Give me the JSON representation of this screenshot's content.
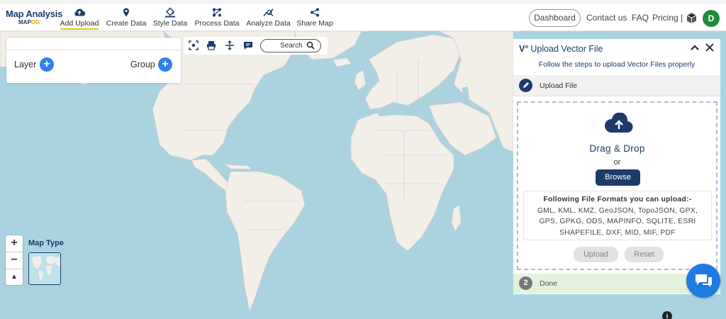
{
  "brand": {
    "title": "Map Analysis",
    "sub_prefix": "MAP",
    "sub_accent": "OG"
  },
  "nav": {
    "items": [
      {
        "label": "Add Upload",
        "icon": "cloud-upload-icon",
        "active": true
      },
      {
        "label": "Create Data",
        "icon": "map-pin-icon"
      },
      {
        "label": "Style Data",
        "icon": "paint-bucket-icon"
      },
      {
        "label": "Process Data",
        "icon": "process-nodes-icon"
      },
      {
        "label": "Analyze Data",
        "icon": "analyze-chart-icon"
      },
      {
        "label": "Share Map",
        "icon": "share-icon"
      }
    ],
    "dashboard_label": "Dashboard",
    "contact_label": "Contact us",
    "faq_label": "FAQ",
    "pricing_label": "Pricing |",
    "avatar_letter": "D"
  },
  "layer_panel": {
    "layer_label": "Layer",
    "group_label": "Group"
  },
  "map_toolbar": {
    "search_label": "Search"
  },
  "map_controls": {
    "zoom_in": "+",
    "zoom_out": "−",
    "north": "▲",
    "map_type_label": "Map Type"
  },
  "upload_panel": {
    "title": "Upload Vector File",
    "subtitle": "Follow the steps to upload Vector Files properly",
    "step1_label": "Upload File",
    "drag_drop": "Drag & Drop",
    "or": "or",
    "browse": "Browse",
    "formats_heading": "Following File Formats you can upload:-",
    "formats_line1": "GML, KML, KMZ, GeoJSON, TopoJSON, GPX,",
    "formats_line2": "GPS, GPKG, ODS, MAPINFO, SQLITE, ESRI",
    "formats_line3": "SHAPEFILE, DXF, MID, MIF, PDF",
    "upload_button": "Upload",
    "reset_button": "Reset",
    "step2_number": "2",
    "step2_label": "Done"
  },
  "colors": {
    "brand_navy": "#1d3b6a",
    "accent_yellow": "#f2c200",
    "water": "#aad3df",
    "land": "#f2efe9",
    "avatar_green": "#1f8b3a",
    "chat_blue": "#1e7be0",
    "step_done_bg": "#e3f2dc"
  }
}
